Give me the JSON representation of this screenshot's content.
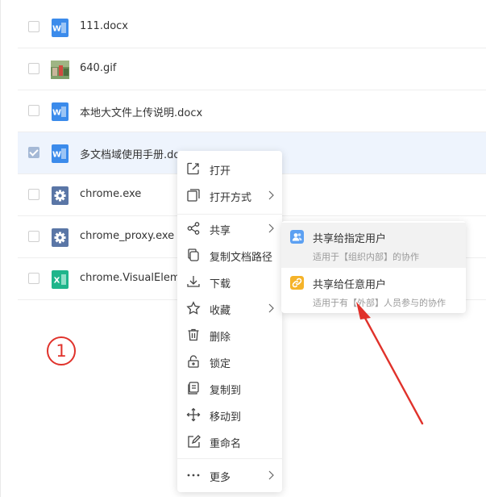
{
  "files": [
    {
      "name": "111.docx",
      "type": "word",
      "checked": false
    },
    {
      "name": "640.gif",
      "type": "image",
      "checked": false
    },
    {
      "name": "本地大文件上传说明.docx",
      "type": "word",
      "checked": false
    },
    {
      "name": "多文档域使用手册.doc",
      "type": "word",
      "checked": true
    },
    {
      "name": "chrome.exe",
      "type": "exe",
      "checked": false
    },
    {
      "name": "chrome_proxy.exe",
      "type": "exe",
      "checked": false
    },
    {
      "name": "chrome.VisualEleme",
      "type": "excel",
      "checked": false
    }
  ],
  "context_menu": {
    "items": [
      {
        "label": "打开",
        "icon": "open-icon",
        "has_arrow": false
      },
      {
        "label": "打开方式",
        "icon": "open-with-icon",
        "has_arrow": true
      },
      {
        "label": "共享",
        "icon": "share-icon",
        "has_arrow": true
      },
      {
        "label": "复制文档路径",
        "icon": "copy-path-icon",
        "has_arrow": false
      },
      {
        "label": "下载",
        "icon": "download-icon",
        "has_arrow": false
      },
      {
        "label": "收藏",
        "icon": "star-icon",
        "has_arrow": true
      },
      {
        "label": "删除",
        "icon": "trash-icon",
        "has_arrow": false
      },
      {
        "label": "锁定",
        "icon": "lock-icon",
        "has_arrow": false
      },
      {
        "label": "复制到",
        "icon": "copy-to-icon",
        "has_arrow": false
      },
      {
        "label": "移动到",
        "icon": "move-icon",
        "has_arrow": false
      },
      {
        "label": "重命名",
        "icon": "rename-icon",
        "has_arrow": false
      },
      {
        "label": "更多",
        "icon": "more-icon",
        "has_arrow": true
      }
    ]
  },
  "share_submenu": {
    "items": [
      {
        "title": "共享给指定用户",
        "desc": "适用于【组织内部】的协作",
        "icon": "users-icon"
      },
      {
        "title": "共享给任意用户",
        "desc": "适用于有【外部】人员参与的协作",
        "icon": "link-icon"
      }
    ]
  },
  "annotation": {
    "step": "1"
  },
  "colors": {
    "word_blue": "#3b8beb",
    "exe_blue": "#5a76a6",
    "excel_green": "#1fb58b",
    "users_icon": "#5ca0f2",
    "link_icon": "#f5b32a",
    "selected_row": "#eef4fd",
    "annotation_red": "#e0322b"
  }
}
